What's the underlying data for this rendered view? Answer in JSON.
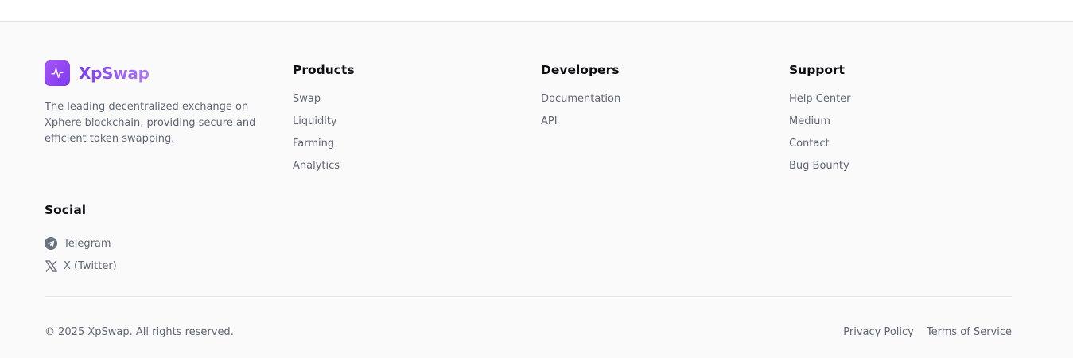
{
  "brand": {
    "name": "XpSwap",
    "tagline": "The leading decentralized exchange on Xphere blockchain, providing secure and efficient token swapping.",
    "logo_icon": "activity-pulse-icon",
    "accent_color": "#8b5cf6"
  },
  "columns": {
    "products": {
      "title": "Products",
      "links": [
        "Swap",
        "Liquidity",
        "Farming",
        "Analytics"
      ]
    },
    "developers": {
      "title": "Developers",
      "links": [
        "Documentation",
        "API"
      ]
    },
    "support": {
      "title": "Support",
      "links": [
        "Help Center",
        "Medium",
        "Contact",
        "Bug Bounty"
      ]
    }
  },
  "social": {
    "title": "Social",
    "items": [
      {
        "label": "Telegram",
        "icon": "telegram-icon"
      },
      {
        "label": "X (Twitter)",
        "icon": "x-twitter-icon"
      }
    ]
  },
  "bottom": {
    "copyright": "© 2025 XpSwap. All rights reserved.",
    "privacy": "Privacy Policy",
    "terms": "Terms of Service"
  }
}
